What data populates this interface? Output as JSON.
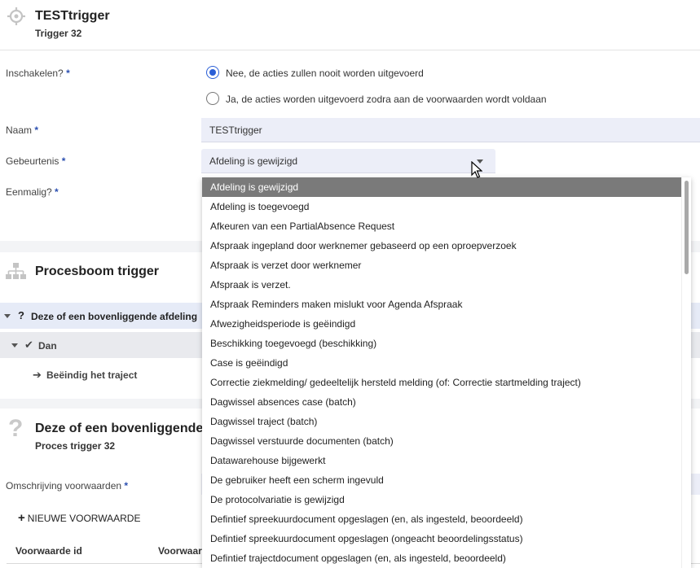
{
  "header": {
    "title": "TESTtrigger",
    "subtitle": "Trigger 32"
  },
  "form": {
    "enable_label": "Inschakelen?",
    "required_mark": "*",
    "radio_no": "Nee, de acties zullen nooit worden uitgevoerd",
    "radio_yes": "Ja, de acties worden uitgevoerd zodra aan de voorwaarden wordt voldaan",
    "radio_selected": "no",
    "name_label": "Naam",
    "name_value": "TESTtrigger",
    "event_label": "Gebeurtenis",
    "event_value": "Afdeling is gewijzigd",
    "once_label": "Eenmalig?"
  },
  "process_tree": {
    "title": "Procesboom trigger",
    "node1_q": "?",
    "node1_label": "Deze of een bovenliggende afdeling",
    "node2_label": "Dan",
    "node3_label": "Beëindig het traject"
  },
  "condition_card": {
    "title": "Deze of een bovenliggende a",
    "subtitle": "Proces trigger 32",
    "description_label": "Omschrijving voorwaarden",
    "new_condition_button": "NIEUWE VOORWAARDE",
    "columns": [
      "Voorwaarde id",
      "Voorwaar"
    ]
  },
  "dropdown": {
    "selected_index": 0,
    "options": [
      "Afdeling is gewijzigd",
      "Afdeling is toegevoegd",
      "Afkeuren van een PartialAbsence Request",
      "Afspraak ingepland door werknemer gebaseerd op een oproepverzoek",
      "Afspraak is verzet door werknemer",
      "Afspraak is verzet.",
      "Afspraak Reminders maken mislukt voor Agenda Afspraak",
      "Afwezigheidsperiode is geëindigd",
      "Beschikking toegevoegd (beschikking)",
      "Case is geëindigd",
      "Correctie ziekmelding/ gedeeltelijk hersteld melding (of: Correctie startmelding traject)",
      "Dagwissel absences case (batch)",
      "Dagwissel traject (batch)",
      "Dagwissel verstuurde documenten (batch)",
      "Datawarehouse bijgewerkt",
      "De gebruiker heeft een scherm ingevuld",
      "De protocolvariatie is gewijzigd",
      "Defintief spreekuurdocument opgeslagen (en, als ingesteld, beoordeeld)",
      "Defintief spreekuurdocument opgeslagen (ongeacht beoordelingsstatus)",
      "Defintief trajectdocument opgeslagen (en, als ingesteld, beoordeeld)"
    ]
  },
  "colors": {
    "accent": "#2b5fd6",
    "field_bg": "#eceef8",
    "selected_option_bg": "#7a7a7a",
    "tree_highlight": "#e6ebf7"
  }
}
